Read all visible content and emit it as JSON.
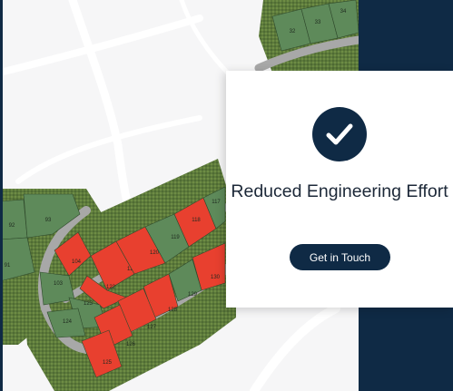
{
  "card": {
    "title": "Reduced Engineering Effort",
    "button_label": "Get in Touch",
    "icon": "checkmark-icon"
  },
  "map": {
    "lots": [
      {
        "number": "32",
        "status": "available"
      },
      {
        "number": "33",
        "status": "available"
      },
      {
        "number": "34",
        "status": "available"
      },
      {
        "number": "92",
        "status": "available"
      },
      {
        "number": "93",
        "status": "available"
      },
      {
        "number": "91",
        "status": "available"
      },
      {
        "number": "104",
        "status": "sold"
      },
      {
        "number": "103",
        "status": "available"
      },
      {
        "number": "121",
        "status": "sold"
      },
      {
        "number": "120",
        "status": "sold"
      },
      {
        "number": "119",
        "status": "available"
      },
      {
        "number": "118",
        "status": "sold"
      },
      {
        "number": "117",
        "status": "available"
      },
      {
        "number": "122",
        "status": "sold"
      },
      {
        "number": "123",
        "status": "available"
      },
      {
        "number": "124",
        "status": "available"
      },
      {
        "number": "130",
        "status": "sold"
      },
      {
        "number": "129",
        "status": "available"
      },
      {
        "number": "128",
        "status": "sold"
      },
      {
        "number": "127",
        "status": "sold"
      },
      {
        "number": "126",
        "status": "sold"
      },
      {
        "number": "125",
        "status": "sold"
      }
    ],
    "colors": {
      "available": "#5e8a5a",
      "sold": "#e8402f",
      "road": "#a8a8a8",
      "hedge": "#5d7a3c",
      "background": "#f6f6f7",
      "navy": "#0f2a45"
    }
  }
}
